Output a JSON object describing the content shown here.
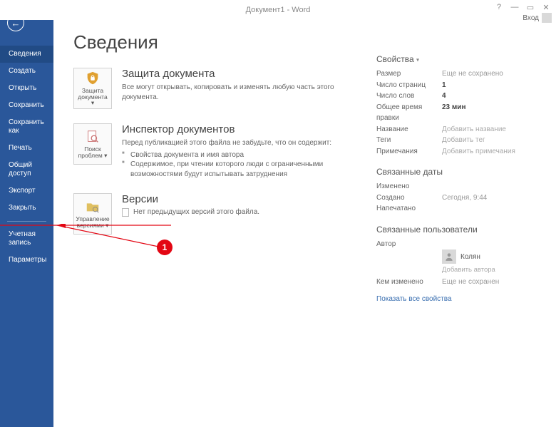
{
  "window": {
    "title": "Документ1 - Word",
    "login": "Вход"
  },
  "sidebar": {
    "items": [
      "Сведения",
      "Создать",
      "Открыть",
      "Сохранить",
      "Сохранить как",
      "Печать",
      "Общий доступ",
      "Экспорт",
      "Закрыть"
    ],
    "bottom": [
      "Учетная запись",
      "Параметры"
    ],
    "active": 0
  },
  "page": {
    "title": "Сведения"
  },
  "sections": {
    "protect": {
      "tile": "Защита документа ▾",
      "heading": "Защита документа",
      "desc": "Все могут открывать, копировать и изменять любую часть этого документа."
    },
    "inspect": {
      "tile": "Поиск проблем ▾",
      "heading": "Инспектор документов",
      "desc": "Перед публикацией этого файла не забудьте, что он содержит:",
      "bullets": [
        "Свойства документа и имя автора",
        "Содержимое, при чтении которого люди с ограниченными возможностями будут испытывать затруднения"
      ]
    },
    "versions": {
      "tile": "Управление версиями ▾",
      "heading": "Версии",
      "none": "Нет предыдущих версий этого файла."
    }
  },
  "props": {
    "heading": "Свойства",
    "rows": {
      "size_k": "Размер",
      "size_v": "Еще не сохранено",
      "pages_k": "Число страниц",
      "pages_v": "1",
      "words_k": "Число слов",
      "words_v": "4",
      "edit_k": "Общее время правки",
      "edit_v": "23 мин",
      "title_k": "Название",
      "title_v": "Добавить название",
      "tags_k": "Теги",
      "tags_v": "Добавить тег",
      "notes_k": "Примечания",
      "notes_v": "Добавить примечания"
    }
  },
  "dates": {
    "heading": "Связанные даты",
    "rows": {
      "mod_k": "Изменено",
      "mod_v": "",
      "created_k": "Создано",
      "created_v": "Сегодня, 9:44",
      "printed_k": "Напечатано",
      "printed_v": ""
    }
  },
  "people": {
    "heading": "Связанные пользователи",
    "author_k": "Автор",
    "author_name": "Колян",
    "add_author": "Добавить автора",
    "changed_k": "Кем изменено",
    "changed_v": "Еще не сохранен"
  },
  "show_all": "Показать все свойства",
  "annotation": {
    "badge": "1"
  }
}
